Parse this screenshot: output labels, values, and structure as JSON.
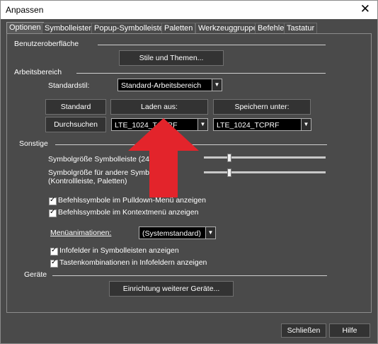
{
  "window": {
    "title": "Anpassen",
    "close_glyph": "✕"
  },
  "tabs": [
    "Optionen",
    "Symbolleisten",
    "Popup-Symbolleisten",
    "Paletten",
    "Werkzeuggruppen",
    "Befehle",
    "Tastatur"
  ],
  "sections": {
    "ui": {
      "title": "Benutzeroberfläche",
      "stile_button": "Stile und Themen..."
    },
    "workspace": {
      "title": "Arbeitsbereich",
      "standardstil_label": "Standardstil:",
      "standardstil_value": "Standard-Arbeitsbereich",
      "standard_button": "Standard",
      "laden_button": "Laden aus:",
      "speichern_button": "Speichern unter:",
      "durchsuchen_button": "Durchsuchen",
      "laden_value": "LTE_1024_TCPRF",
      "speichern_value": "LTE_1024_TCPRF"
    },
    "other": {
      "title": "Sonstige",
      "symbolgroesse_label": "Symbolgröße Symbolleiste (24,",
      "symbolgroesse_value": 0.2,
      "symbolgroesse_andere_line1": "Symbolgröße für andere Symbo         ):",
      "symbolgroesse_andere_line2": "(Kontrollleiste, Paletten)",
      "symbolgroesse_andere_value": 0.2,
      "check1": "Befehlssymbole im Pulldown-Menü anzeigen",
      "check2": "Befehlssymbole im Kontextmenü anzeigen",
      "menuanim_label": "Menüanimationen:",
      "menuanim_value": "(Systemstandard)",
      "check3": "Infofelder in Symbolleisten anzeigen",
      "check4": "Tastenkombinationen in Infofeldern anzeigen"
    },
    "devices": {
      "title": "Geräte",
      "button": "Einrichtung weiterer Geräte..."
    }
  },
  "footer": {
    "close_button": "Schließen",
    "help_button": "Hilfe"
  },
  "annotation": {
    "arrow_color": "#e3242b"
  }
}
